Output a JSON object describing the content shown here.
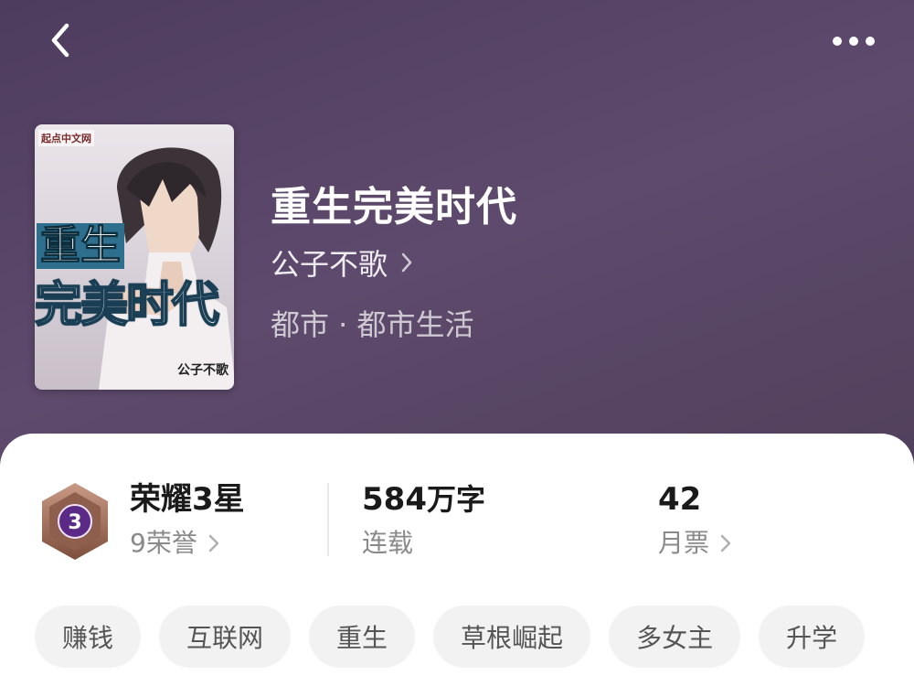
{
  "header": {
    "back_icon": "chevron-left-icon",
    "more_icon": "more-dots-icon"
  },
  "book": {
    "title": "重生完美时代",
    "author": "公子不歌",
    "genre": "都市 · 都市生活",
    "cover": {
      "publisher": "起点中文网",
      "title_line1": "重生",
      "title_line2": "完美时代",
      "author": "公子不歌"
    }
  },
  "stats": {
    "honor": {
      "badge_number": "3",
      "title": "荣耀3星",
      "label": "9荣誉"
    },
    "words": {
      "value": "584",
      "unit": "万字",
      "label": "连载"
    },
    "monthly_ticket": {
      "value": "42",
      "label": "月票"
    }
  },
  "tags": [
    "赚钱",
    "互联网",
    "重生",
    "草根崛起",
    "多女主",
    "升学"
  ],
  "colors": {
    "header_bg": "#54425f",
    "badge_purple": "#5b2a86",
    "badge_bronze": "#a87560"
  }
}
